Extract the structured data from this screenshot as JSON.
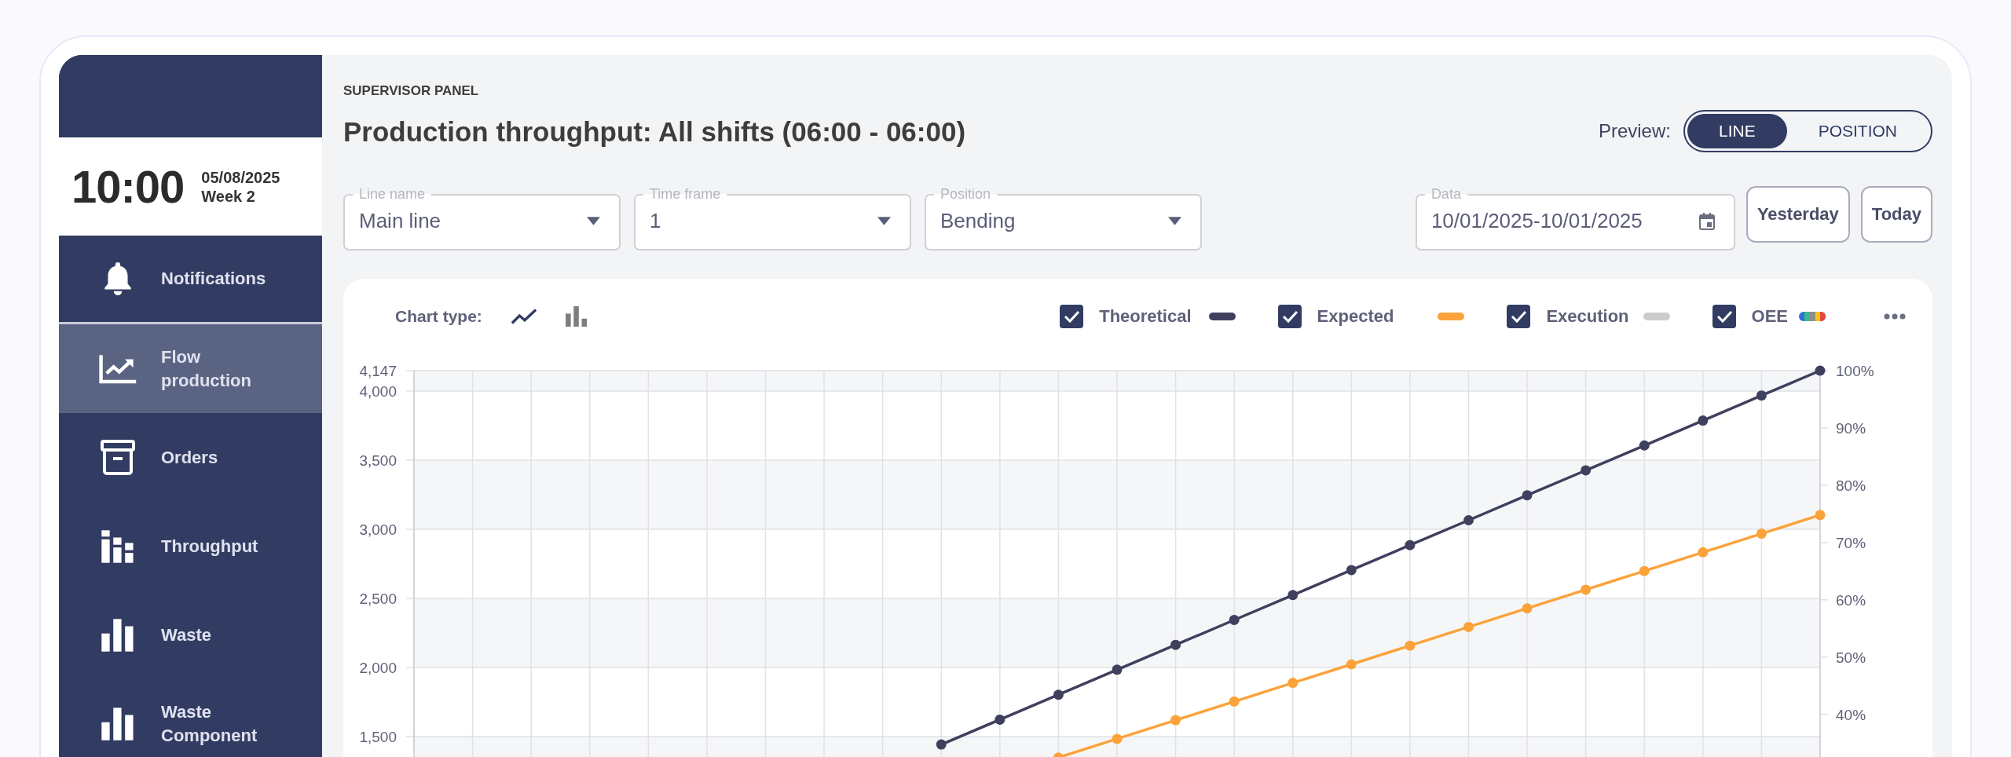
{
  "sidebar": {
    "clock": {
      "time": "10:00",
      "date": "05/08/2025",
      "week": "Week 2"
    },
    "items": [
      {
        "kind": "bell",
        "label": "Notifications",
        "selected": false
      },
      {
        "kind": "trend",
        "label": "Flow production",
        "selected": true
      },
      {
        "kind": "box",
        "label": "Orders",
        "selected": false
      },
      {
        "kind": "stacked",
        "label": "Throughput",
        "selected": false
      },
      {
        "kind": "columns",
        "label": "Waste",
        "selected": false
      },
      {
        "kind": "columns",
        "label": "Waste Component",
        "selected": false
      }
    ]
  },
  "header": {
    "eyebrow": "SUPERVISOR PANEL",
    "title": "Production throughput: All shifts (06:00 - 06:00)",
    "preview_label": "Preview:",
    "preview_options": [
      {
        "label": "LINE",
        "selected": true
      },
      {
        "label": "POSITION",
        "selected": false
      }
    ]
  },
  "filters": [
    {
      "label": "Line name",
      "value": "Main line"
    },
    {
      "label": "Time frame",
      "value": "1"
    },
    {
      "label": "Position",
      "value": "Bending"
    }
  ],
  "date_filter": {
    "label": "Data",
    "value": "10/01/2025-10/01/2025",
    "buttons": [
      "Yesterday",
      "Today"
    ]
  },
  "chart_panel": {
    "chart_type_label": "Chart type:",
    "chart_types": [
      {
        "kind": "line",
        "selected": true
      },
      {
        "kind": "bar",
        "selected": false
      }
    ],
    "legend": [
      {
        "checked": true,
        "kind": "solid",
        "color": "#3f3f5e"
      },
      {
        "checked": true,
        "kind": "solid",
        "color": "#fba33a"
      },
      {
        "label": "Execution",
        "checked": true,
        "kind": "solid",
        "color": "#cccccc"
      },
      {
        "label": "OEE",
        "checked": true,
        "kind": "multicolor"
      }
    ],
    "chart_data": {
      "type": "line",
      "grid": true,
      "ylim": [
        1313,
        4147
      ],
      "yticks": [
        {
          "value": 1500,
          "label": "1,500"
        },
        {
          "value": 2000,
          "label": "2,000"
        },
        {
          "value": 2500,
          "label": "2,500"
        },
        {
          "value": 3000,
          "label": "3,000"
        },
        {
          "value": 3500,
          "label": "3,500"
        },
        {
          "value": 4000,
          "label": "4,000"
        },
        {
          "value": 4147,
          "label": "4,147"
        }
      ],
      "y2lim": [
        31.6,
        100
      ],
      "y2ticks": [
        {
          "value": 40,
          "label": "40%"
        },
        {
          "value": 50,
          "label": "50%"
        },
        {
          "value": 60,
          "label": "60%"
        },
        {
          "value": 70,
          "label": "70%"
        },
        {
          "value": 80,
          "label": "80%"
        },
        {
          "value": 90,
          "label": "90%"
        },
        {
          "value": 100,
          "label": "100%"
        }
      ],
      "series": [
        {
          "name": "Theoretical",
          "color": "#3f3f5e",
          "marker": true,
          "values": [
            null,
            null,
            null,
            null,
            null,
            null,
            null,
            null,
            null,
            1443,
            1623,
            1803,
            1984,
            2164,
            2344,
            2524,
            2705,
            2885,
            3065,
            3246,
            3426,
            3606,
            3786,
            3967,
            4147
          ]
        },
        {
          "name": "Expected",
          "color": "#fba33a",
          "marker": true,
          "values": [
            null,
            null,
            null,
            null,
            null,
            null,
            null,
            null,
            null,
            null,
            null,
            1349,
            1484,
            1619,
            1754,
            1889,
            2023,
            2158,
            2293,
            2428,
            2563,
            2698,
            2833,
            2968,
            3103
          ]
        }
      ]
    }
  }
}
